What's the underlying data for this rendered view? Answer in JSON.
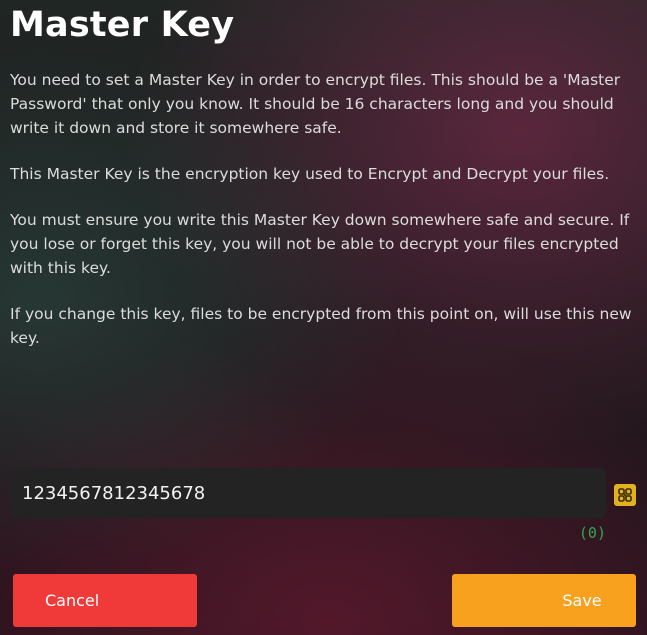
{
  "dialog": {
    "title": "Master Key",
    "paragraphs": [
      "You need to set a Master Key in order to encrypt files. This should be a 'Master Password' that only you know. It should be 16 characters long and you should write it down and store it somewhere safe.",
      "This Master Key is the encryption key used to Encrypt and Decrypt your files.",
      "You must ensure you write this Master Key down somewhere safe and secure. If you lose or forget this key, you will not be able to decrypt your files encrypted with this key.",
      "If you change this key, files to be encrypted from this point on, will use this new key."
    ]
  },
  "key_input": {
    "value": "1234567812345678",
    "counter": "(0)",
    "generate_icon": "generate-key-icon"
  },
  "buttons": {
    "cancel_label": "Cancel",
    "save_label": "Save"
  },
  "colors": {
    "cancel": "#f03a3a",
    "save": "#f7a11f",
    "icon": "#e3b21f",
    "counter": "#2fa84f"
  }
}
